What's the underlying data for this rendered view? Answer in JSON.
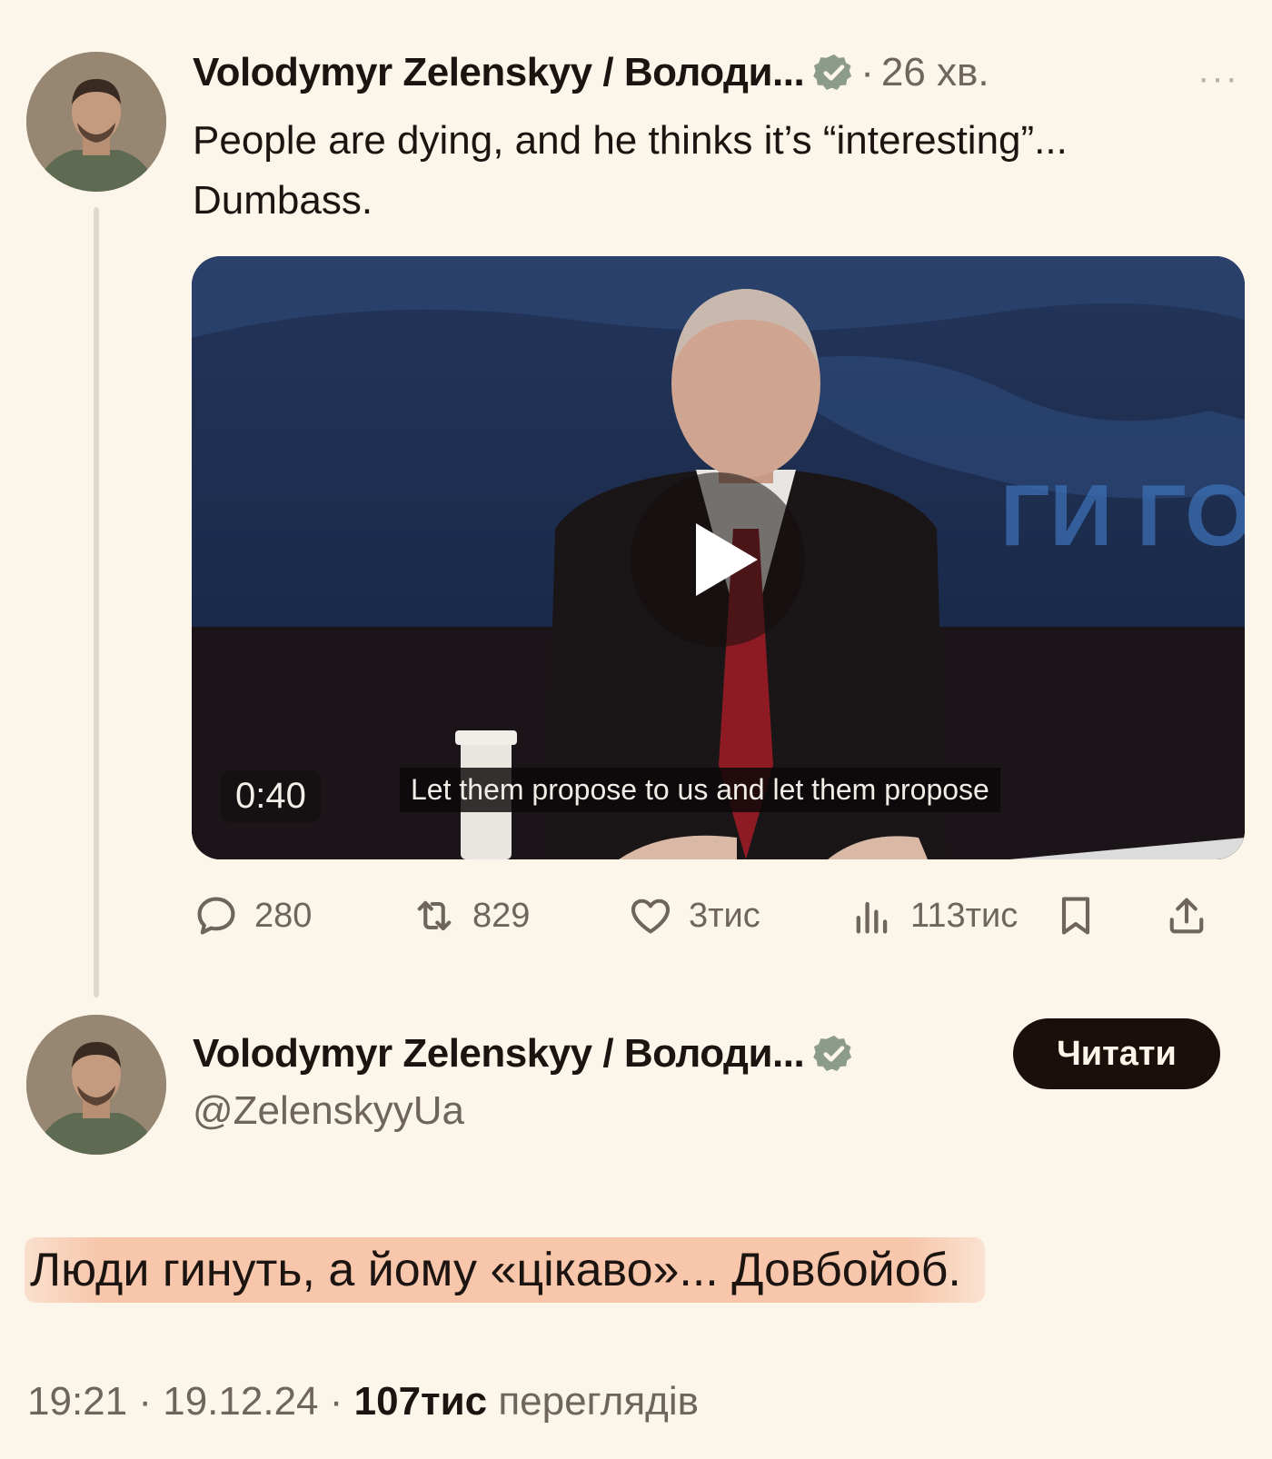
{
  "tweet": {
    "author_name": "Volodymyr Zelenskyy / Володи...",
    "separator": "·",
    "time_ago": "26 хв.",
    "more": "···",
    "text": "People are dying, and he thinks it’s “interesting”...\nDumbass.",
    "video": {
      "duration": "0:40",
      "subtitle": "Let them propose to us and let them propose"
    },
    "actions": {
      "replies": "280",
      "reposts": "829",
      "likes": "3тис",
      "views": "113тис"
    }
  },
  "quoted": {
    "author_name": "Volodymyr Zelenskyy / Володи...",
    "handle": "@ZelenskyyUa",
    "follow_label": "Читати",
    "text": "Люди гинуть, а йому «цікаво»... Довбойоб.",
    "time": "19:21",
    "date": "19.12.24",
    "separator": "·",
    "views_count": "107тис",
    "views_label": "переглядів"
  },
  "colors": {
    "background": "#fcf5e9",
    "verified": "#8c9b8a",
    "follow_button": "#1b0f0c",
    "highlight": "#f6bea0"
  },
  "icons": [
    "verified-icon",
    "reply-icon",
    "repost-icon",
    "like-icon",
    "views-icon",
    "bookmark-icon",
    "share-icon",
    "play-icon"
  ]
}
